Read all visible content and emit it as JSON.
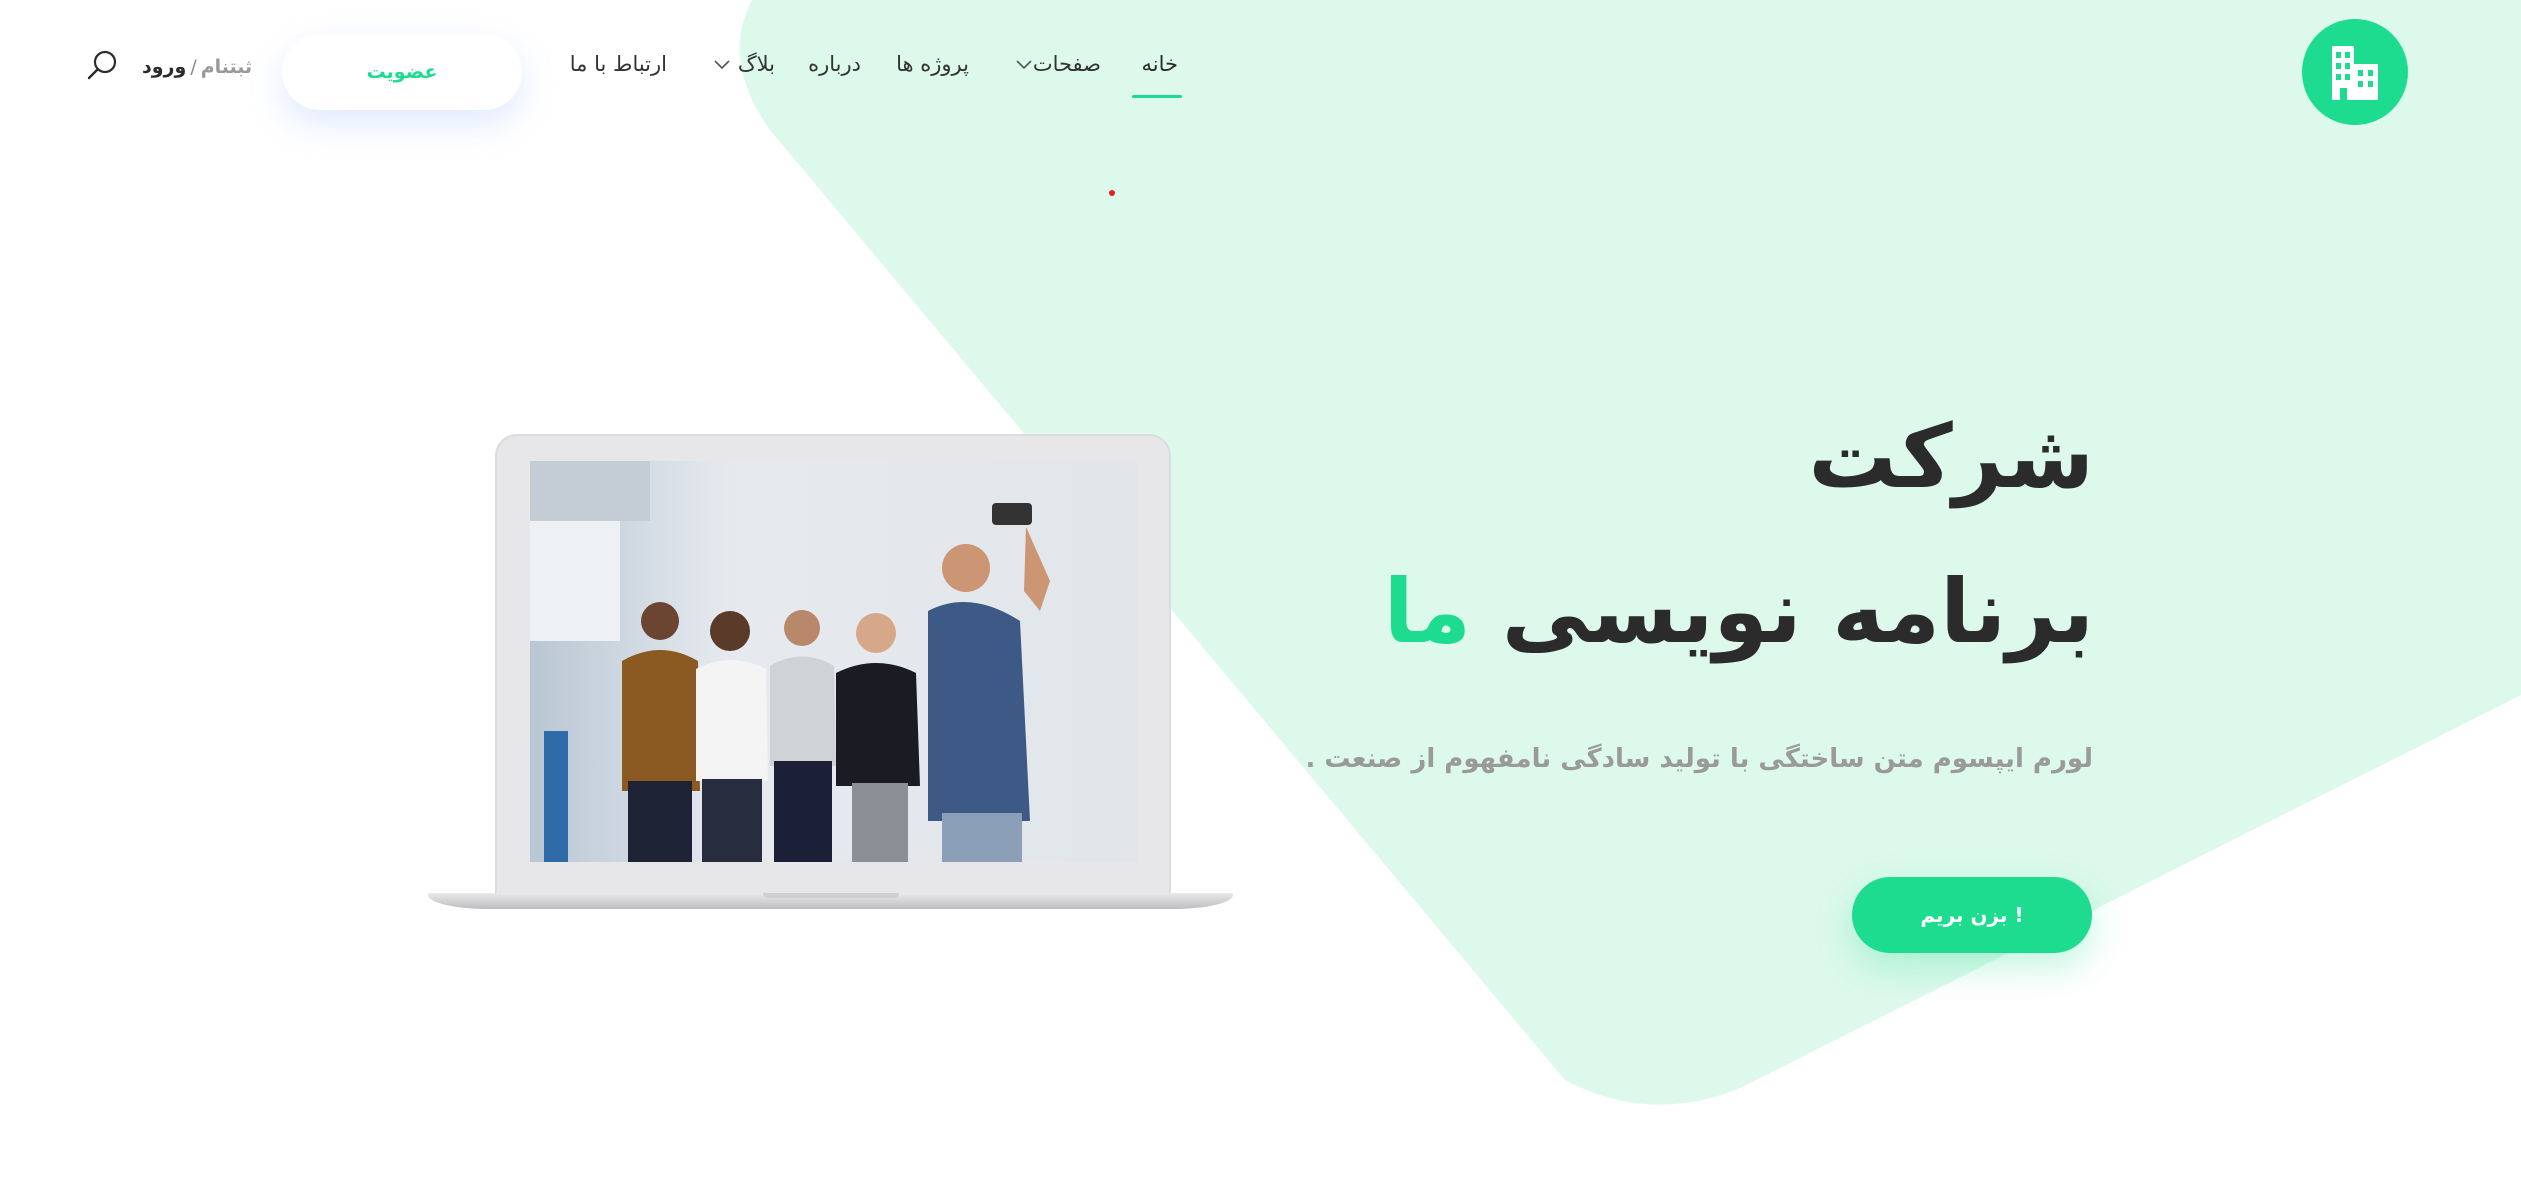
{
  "colors": {
    "accent": "#1ddc8f",
    "accent_light_bg": "#ddf9ec",
    "text_dark": "#2b2b2b",
    "text_muted": "#9a9a9a"
  },
  "header": {
    "logo_icon": "building-icon",
    "nav": {
      "home": "خانه",
      "pages": "صفحات",
      "projects": "پروژه ها",
      "about": "درباره",
      "blog": "بلاگ",
      "contact": "ارتباط با ما"
    },
    "active_nav": "home",
    "signup_label": "عضویت",
    "login_label": "ورود",
    "separator": "/",
    "register_label": "ثبتنام",
    "search_icon": "search-icon"
  },
  "hero": {
    "title_line1": "شرکت",
    "title_line2_main": "برنامه نویسی",
    "title_line2_accent": "ما",
    "subtitle": "لورم ایپسوم متن ساختگی با تولید سادگی نامفهوم از صنعت .",
    "cta_label": "بزن بریم !",
    "image_icon": "laptop-photo"
  }
}
